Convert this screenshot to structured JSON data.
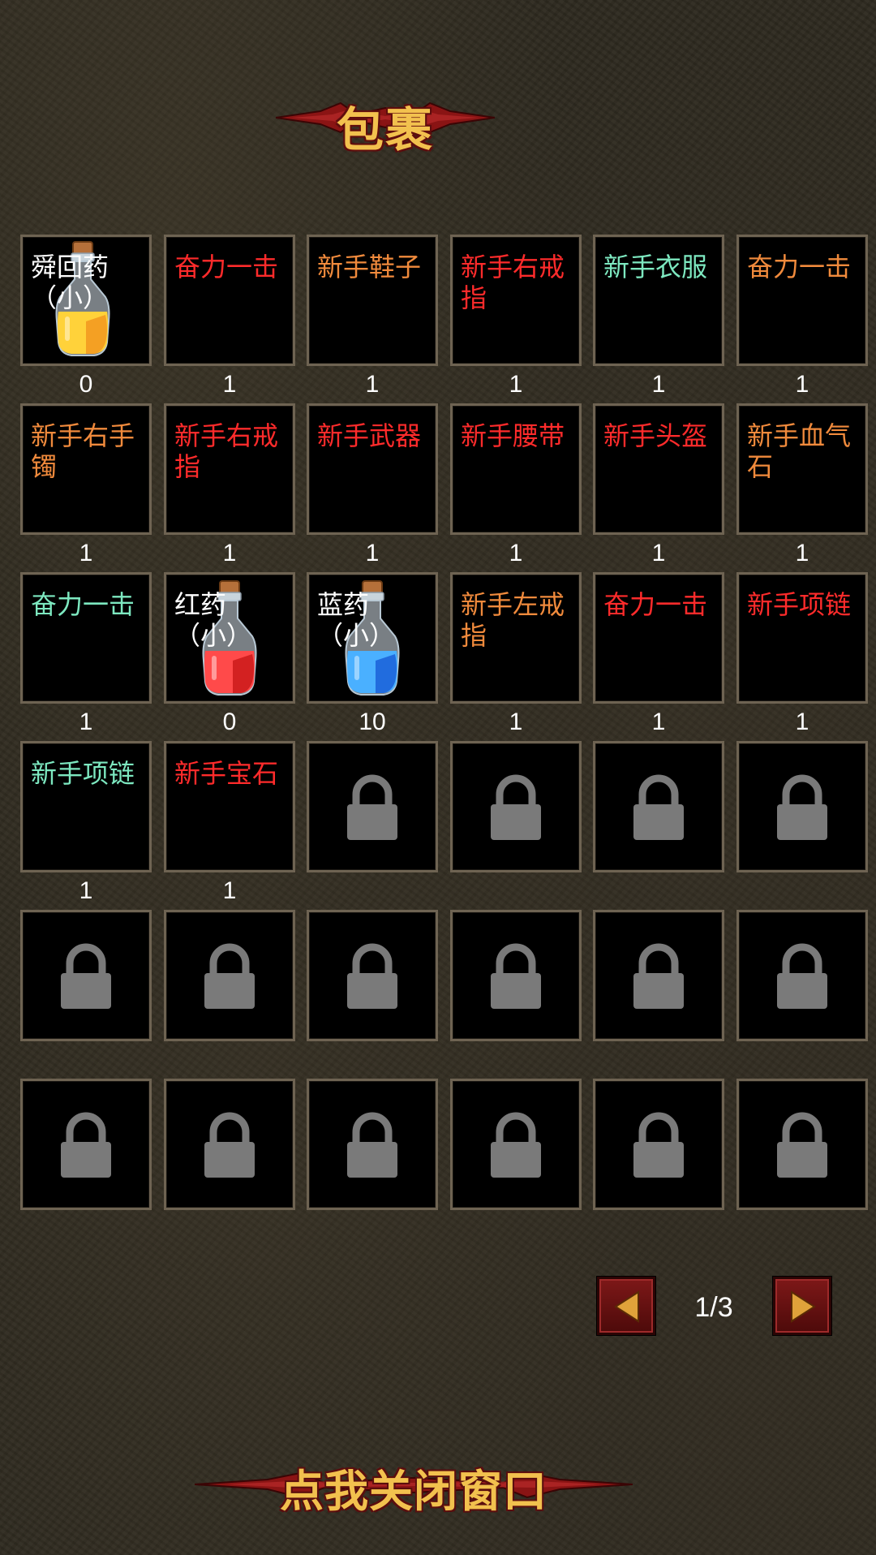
{
  "title": "包裹",
  "colors": {
    "white": "#ffffff",
    "red": "#ff2b2b",
    "orange": "#f08a3c",
    "cyan": "#7de8c0",
    "slot_border": "#6e6352",
    "lock_gray": "#7a7a7a"
  },
  "slots": [
    {
      "name": "舜回药（小）",
      "color": "white",
      "qty": "0",
      "icon": "yellow-potion-icon"
    },
    {
      "name": "奋力一击",
      "color": "red",
      "qty": "1"
    },
    {
      "name": "新手鞋子",
      "color": "orange",
      "qty": "1"
    },
    {
      "name": "新手右戒指",
      "color": "red",
      "qty": "1"
    },
    {
      "name": "新手衣服",
      "color": "cyan",
      "qty": "1"
    },
    {
      "name": "奋力一击",
      "color": "orange",
      "qty": "1"
    },
    {
      "name": "新手右手镯",
      "color": "orange",
      "qty": "1"
    },
    {
      "name": "新手右戒指",
      "color": "red",
      "qty": "1"
    },
    {
      "name": "新手武器",
      "color": "red",
      "qty": "1"
    },
    {
      "name": "新手腰带",
      "color": "red",
      "qty": "1"
    },
    {
      "name": "新手头盔",
      "color": "red",
      "qty": "1"
    },
    {
      "name": "新手血气石",
      "color": "orange",
      "qty": "1"
    },
    {
      "name": "奋力一击",
      "color": "cyan",
      "qty": "1"
    },
    {
      "name": "红药（小）",
      "color": "white",
      "qty": "0",
      "icon": "red-potion-icon"
    },
    {
      "name": "蓝药（小）",
      "color": "white",
      "qty": "10",
      "icon": "blue-potion-icon"
    },
    {
      "name": "新手左戒指",
      "color": "orange",
      "qty": "1"
    },
    {
      "name": "奋力一击",
      "color": "red",
      "qty": "1"
    },
    {
      "name": "新手项链",
      "color": "red",
      "qty": "1"
    },
    {
      "name": "新手项链",
      "color": "cyan",
      "qty": "1"
    },
    {
      "name": "新手宝石",
      "color": "red",
      "qty": "1"
    },
    {
      "locked": true
    },
    {
      "locked": true
    },
    {
      "locked": true
    },
    {
      "locked": true
    },
    {
      "locked": true
    },
    {
      "locked": true
    },
    {
      "locked": true
    },
    {
      "locked": true
    },
    {
      "locked": true
    },
    {
      "locked": true
    },
    {
      "locked": true
    },
    {
      "locked": true
    },
    {
      "locked": true
    },
    {
      "locked": true
    },
    {
      "locked": true
    },
    {
      "locked": true
    }
  ],
  "pagination": {
    "indicator": "1/3",
    "current_page": 1,
    "total_pages": 3,
    "prev_icon": "left-arrow-icon",
    "next_icon": "right-arrow-icon"
  },
  "close_label": "点我关闭窗口"
}
